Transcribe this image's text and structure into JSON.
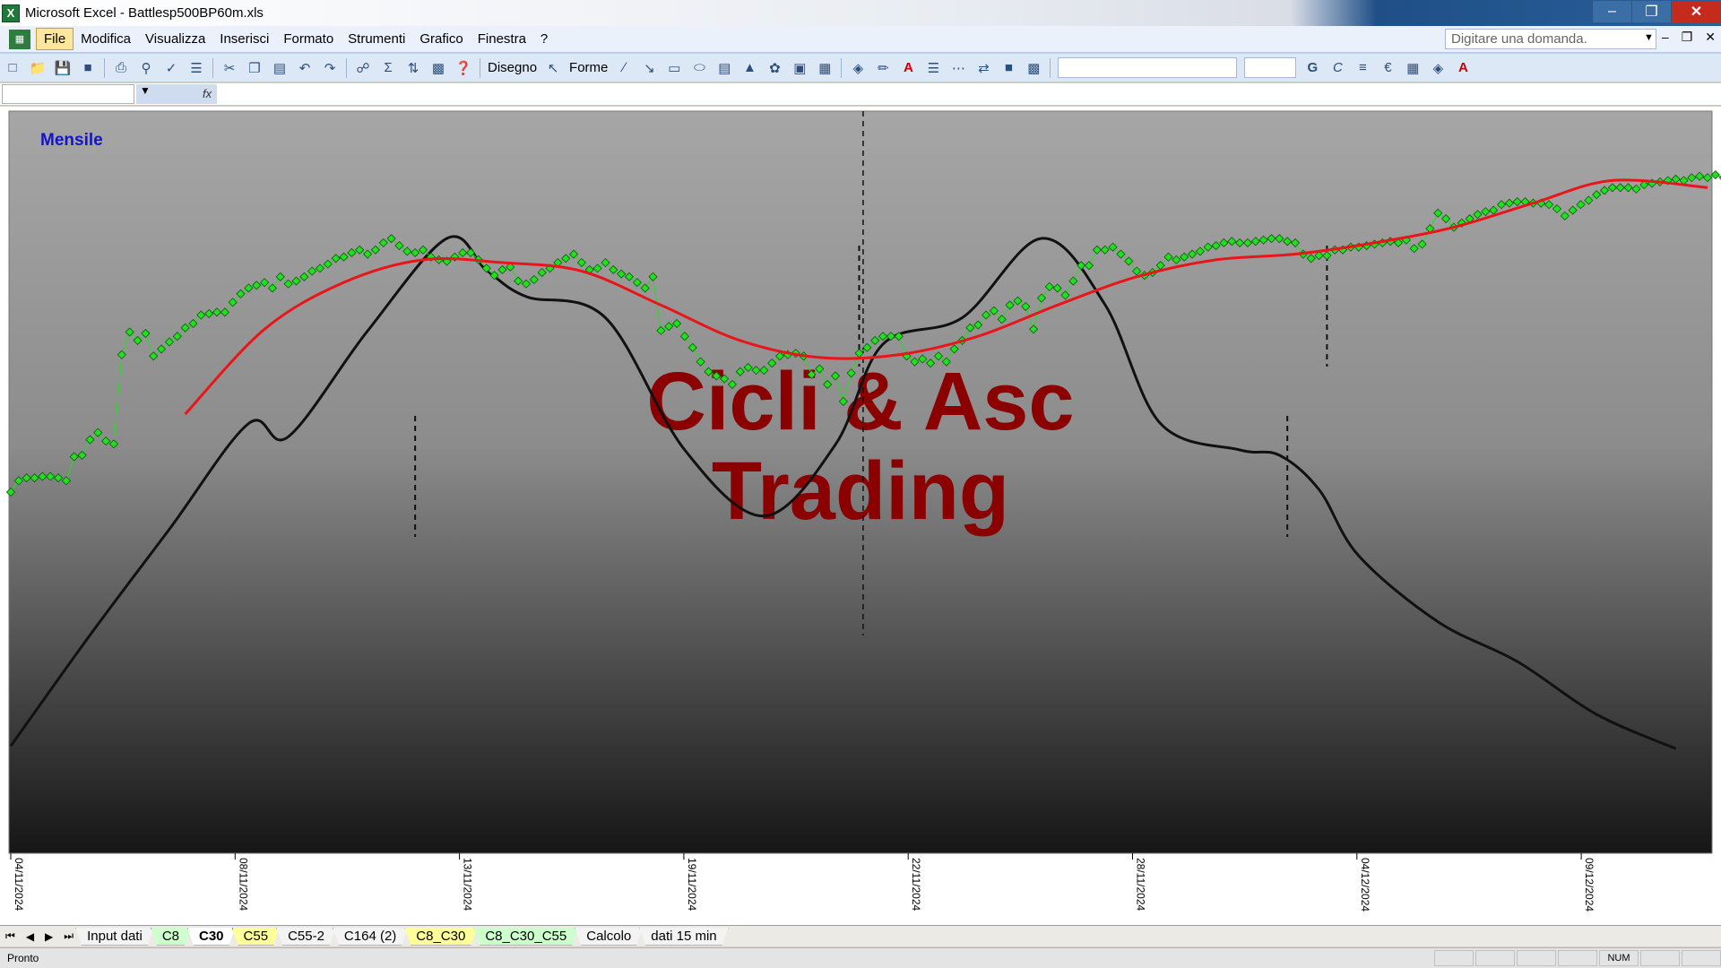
{
  "window": {
    "title": "Microsoft Excel - Battlesp500BP60m.xls"
  },
  "menu": {
    "items": [
      "File",
      "Modifica",
      "Visualizza",
      "Inserisci",
      "Formato",
      "Strumenti",
      "Grafico",
      "Finestra",
      "?"
    ],
    "ask_placeholder": "Digitare una domanda."
  },
  "toolbar": {
    "draw_label": "Disegno",
    "shapes_label": "Forme"
  },
  "sheets": {
    "tabs": [
      "Input dati",
      "C8",
      "C30",
      "C55",
      "C55-2",
      "C164 (2)",
      "C8_C30",
      "C8_C30_C55",
      "Calcolo",
      "dati 15 min"
    ],
    "active": "C30"
  },
  "status": {
    "left": "Pronto",
    "num": "NUM"
  },
  "chart_data": {
    "type": "line",
    "label_top_left": "Mensile",
    "watermark": [
      "Cicli & Asc",
      "Trading"
    ],
    "x_tick_labels": [
      "04/11/2024",
      "08/11/2024",
      "13/11/2024",
      "19/11/2024",
      "22/11/2024",
      "28/11/2024",
      "04/12/2024",
      "09/12/2024"
    ],
    "x_range": [
      0,
      214
    ],
    "grid": false,
    "colors": {
      "price": "#22e01f",
      "average": "#e8161a",
      "cycle": "#111111",
      "label": "#1414c8",
      "watermark": "#8b0000"
    },
    "series": [
      {
        "style": "scatter-line",
        "values": [
          5848,
          5856,
          5858,
          5858,
          5859,
          5859,
          5858,
          5856,
          5873,
          5874,
          5885,
          5890,
          5884,
          5882,
          5945,
          5961,
          5955,
          5960,
          5944,
          5949,
          5954,
          5958,
          5964,
          5967,
          5973,
          5974,
          5975,
          5975,
          5982,
          5988,
          5992,
          5994,
          5996,
          5992,
          6000,
          5995,
          5997,
          6000,
          6004,
          6006,
          6009,
          6013,
          6014,
          6017,
          6019,
          6016,
          6019,
          6024,
          6027,
          6022,
          6018,
          6017,
          6019,
          6014,
          6012,
          6011,
          6014,
          6017,
          6017,
          6012,
          6006,
          6001,
          6005,
          6007,
          5997,
          5995,
          5998,
          6003,
          6006,
          6010,
          6013,
          6016,
          6010,
          6005,
          6006,
          6010,
          6005,
          6002,
          6000,
          5996,
          5992,
          6000,
          5962,
          5965,
          5967,
          5958,
          5950,
          5940,
          5933,
          5930,
          5928,
          5924,
          5933,
          5936,
          5934,
          5934,
          5939,
          5944,
          5945,
          5946,
          5944,
          5931,
          5935,
          5924,
          5930,
          5912,
          5932,
          5946,
          5950,
          5955,
          5958,
          5958,
          5958,
          5944,
          5940,
          5942,
          5939,
          5944,
          5940,
          5949,
          5955,
          5964,
          5966,
          5973,
          5976,
          5970,
          5980,
          5983,
          5979,
          5963,
          5985,
          5993,
          5992,
          5987,
          5997,
          6008,
          6008,
          6019,
          6019,
          6021,
          6016,
          6011,
          6004,
          6001,
          6003,
          6008,
          6014,
          6012,
          6014,
          6016,
          6018,
          6021,
          6022,
          6024,
          6025,
          6024,
          6024,
          6025,
          6026,
          6027,
          6027,
          6025,
          6024,
          6016,
          6013,
          6015,
          6015,
          6019,
          6019,
          6021,
          6021,
          6022,
          6023,
          6024,
          6025,
          6024,
          6026,
          6020,
          6023,
          6034,
          6045,
          6041,
          6035,
          6038,
          6041,
          6044,
          6046,
          6047,
          6051,
          6052,
          6053,
          6053,
          6052,
          6052,
          6051,
          6048,
          6043,
          6047,
          6051,
          6054,
          6058,
          6061,
          6063,
          6063,
          6063,
          6062,
          6065,
          6066,
          6067,
          6068,
          6069,
          6068,
          6070,
          6071,
          6070,
          6072,
          6070,
          6073,
          6075,
          6070,
          6066,
          6069,
          6071,
          6075,
          6076,
          6079,
          6076,
          6073,
          6071,
          6070,
          6072,
          6071,
          6072,
          6072,
          6062,
          6057,
          6062,
          6060,
          6059,
          6056,
          6055,
          6057,
          6056,
          6055,
          6054,
          6051,
          6050,
          6048,
          6046,
          6044,
          6043,
          6042,
          6046,
          6050,
          6058
        ]
      },
      {
        "style": "line",
        "x": [
          22,
          32,
          42,
          52,
          62,
          72,
          82,
          92,
          102,
          112,
          122,
          132,
          142,
          152,
          162,
          172,
          182,
          192,
          202,
          214
        ],
        "values": [
          5903,
          5963,
          5996,
          6012,
          6010,
          6004,
          5980,
          5955,
          5943,
          5945,
          5958,
          5980,
          6000,
          6012,
          6016,
          6024,
          6035,
          6052,
          6068,
          6063
        ]
      },
      {
        "style": "line",
        "x": [
          0,
          10,
          20,
          30,
          35,
          45,
          55,
          60,
          65,
          75,
          85,
          95,
          104,
          110,
          120,
          130,
          138,
          145,
          155,
          160,
          165,
          170,
          180,
          190,
          200,
          210
        ],
        "values": [
          -0.92,
          -0.5,
          -0.1,
          0.3,
          0.25,
          0.65,
          1.0,
          0.88,
          0.78,
          0.7,
          0.2,
          -0.05,
          0.22,
          0.6,
          0.7,
          1.0,
          0.75,
          0.3,
          0.2,
          0.18,
          0.05,
          -0.2,
          -0.45,
          -0.6,
          -0.8,
          -0.93
        ]
      }
    ],
    "cycle_markers": [
      {
        "x": 51,
        "type": "low"
      },
      {
        "x": 107,
        "type": "high"
      },
      {
        "x": 161,
        "type": "low"
      },
      {
        "x": 166,
        "type": "high"
      }
    ]
  }
}
